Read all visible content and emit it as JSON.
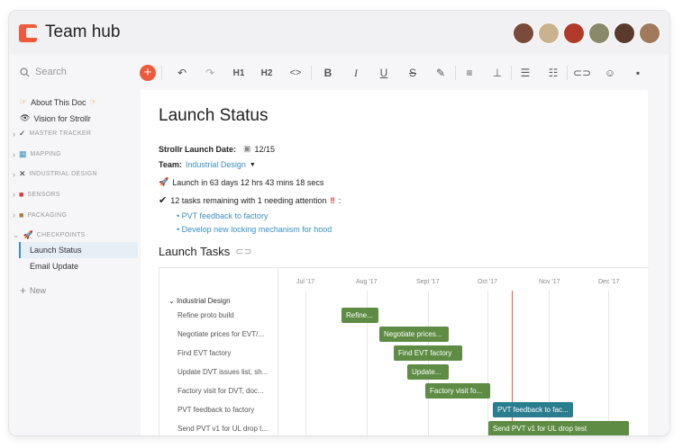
{
  "app": {
    "title": "Team hub"
  },
  "avatars": [
    "#7a4a3a",
    "#c9b28e",
    "#b23a2a",
    "#8a8a6a",
    "#5a3a2a",
    "#a07a5a"
  ],
  "search": {
    "placeholder": "Search"
  },
  "sidebar": {
    "items": [
      {
        "label": "About This Doc",
        "icon": "point-down-emoji"
      },
      {
        "label": "Vision for Strollr",
        "icon": "eye-icon"
      },
      {
        "label": "MASTER TRACKER",
        "icon": "check-icon",
        "section": true
      },
      {
        "label": "MAPPING",
        "icon": "map-icon",
        "section": true
      },
      {
        "label": "INDUSTRIAL DESIGN",
        "icon": "tools-icon",
        "section": true
      },
      {
        "label": "SENSORS",
        "icon": "sensor-icon",
        "section": true
      },
      {
        "label": "PACKAGING",
        "icon": "package-icon",
        "section": true
      },
      {
        "label": "CHECKPOINTS",
        "icon": "rocket-icon",
        "section": true
      },
      {
        "label": "Launch Status",
        "active": true
      },
      {
        "label": "Email Update"
      }
    ],
    "new_label": "New"
  },
  "toolbar": {
    "h1": "H1",
    "h2": "H2",
    "code": "<>",
    "bold": "B",
    "italic": "I",
    "underline": "U",
    "strike": "S"
  },
  "doc": {
    "title": "Launch Status",
    "launch_date_label": "Strollr Launch Date:",
    "launch_date": "12/15",
    "team_label": "Team:",
    "team_value": "Industrial Design",
    "countdown": "Launch in 63 days 12 hrs 43 mins 18 secs",
    "remaining": "12 tasks remaining with 1 needing attention",
    "bullets": [
      "PVT feedback to factory",
      "Develop new locking mechanism for hood"
    ],
    "tasks_heading": "Launch Tasks"
  },
  "gantt": {
    "group": "Industrial Design",
    "months": [
      "Jul '17",
      "Aug '17",
      "Sept '17",
      "Oct '17",
      "Nov '17",
      "Dec '17"
    ],
    "rows": [
      {
        "name": "Refine proto build",
        "bar": "Refine..."
      },
      {
        "name": "Negotiate prices for EVT/...",
        "bar": "Negotiate prices..."
      },
      {
        "name": "Find EVT factory",
        "bar": "Find EVT factory"
      },
      {
        "name": "Update DVT issues list, sh...",
        "bar": "Update..."
      },
      {
        "name": "Factory visit for DVT, doc...",
        "bar": "Factory visit fo..."
      },
      {
        "name": "PVT feedback to factory",
        "bar": "PVT feedback to fac..."
      },
      {
        "name": "Send PVT v1 for UL drop t...",
        "bar": "Send PVT v1 for UL drop test"
      }
    ]
  }
}
